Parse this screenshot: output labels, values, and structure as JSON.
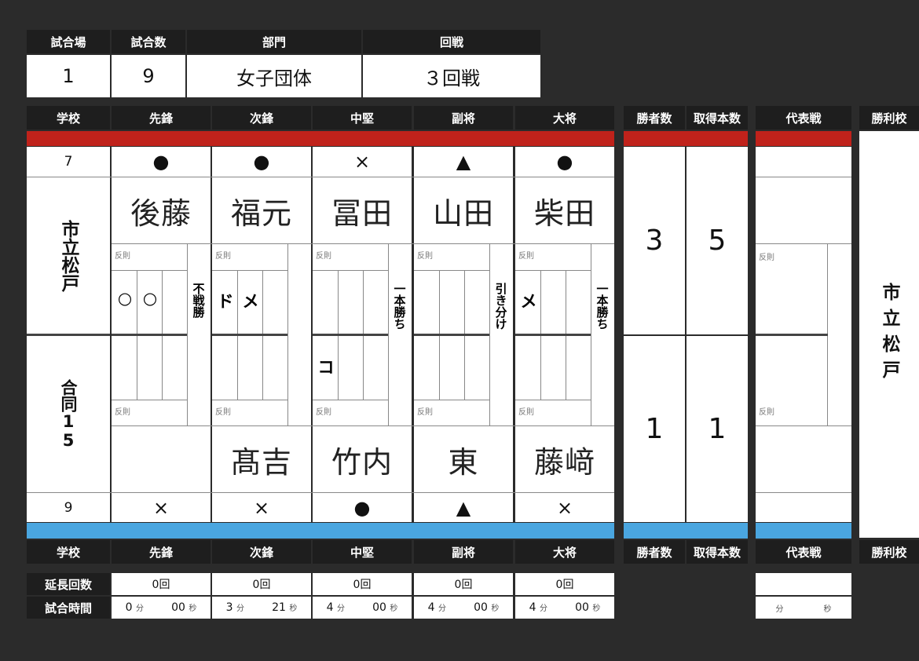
{
  "info": {
    "headers": [
      "試合場",
      "試合数",
      "部門",
      "回戦"
    ],
    "values": [
      "1",
      "9",
      "女子団体",
      "３回戦"
    ]
  },
  "board": {
    "headers": [
      "学校",
      "先鋒",
      "次鋒",
      "中堅",
      "副将",
      "大将"
    ],
    "side_headers": [
      "勝者数",
      "取得本数",
      "代表戦",
      "勝利校"
    ]
  },
  "team_top": {
    "number": "7",
    "name": "市立松戸",
    "marks": [
      "●",
      "●",
      "×",
      "▲",
      "●"
    ],
    "players": [
      "後藤",
      "福元",
      "冨田",
      "山田",
      "柴田"
    ],
    "wins": "3",
    "points": "5"
  },
  "team_bottom": {
    "number": "9",
    "name": "合同15",
    "marks": [
      "×",
      "×",
      "●",
      "▲",
      "×"
    ],
    "players": [
      "",
      "髙吉",
      "竹内",
      "東",
      "藤﨑"
    ],
    "wins": "1",
    "points": "1"
  },
  "bout_labels": [
    "不戦勝",
    "",
    "一本勝ち",
    "引き分け",
    "一本勝ち"
  ],
  "top_scores": [
    [
      "○",
      "○"
    ],
    [
      "ド",
      "メ"
    ],
    [
      "",
      ""
    ],
    [
      "",
      ""
    ],
    [
      "メ",
      ""
    ]
  ],
  "bottom_scores": [
    [
      "",
      ""
    ],
    [
      "",
      ""
    ],
    [
      "コ",
      ""
    ],
    [
      "",
      ""
    ],
    [
      "",
      ""
    ]
  ],
  "hansoku_label": "反則",
  "winner": "市立松戸",
  "extra": {
    "labels": [
      "延長回数",
      "試合時間"
    ],
    "overtime": [
      "0回",
      "0回",
      "0回",
      "0回",
      "0回"
    ],
    "minutes": [
      "0",
      "3",
      "4",
      "4",
      "4"
    ],
    "seconds": [
      "00",
      "21",
      "00",
      "00",
      "00"
    ],
    "min_unit": "分",
    "sec_unit": "秒"
  }
}
